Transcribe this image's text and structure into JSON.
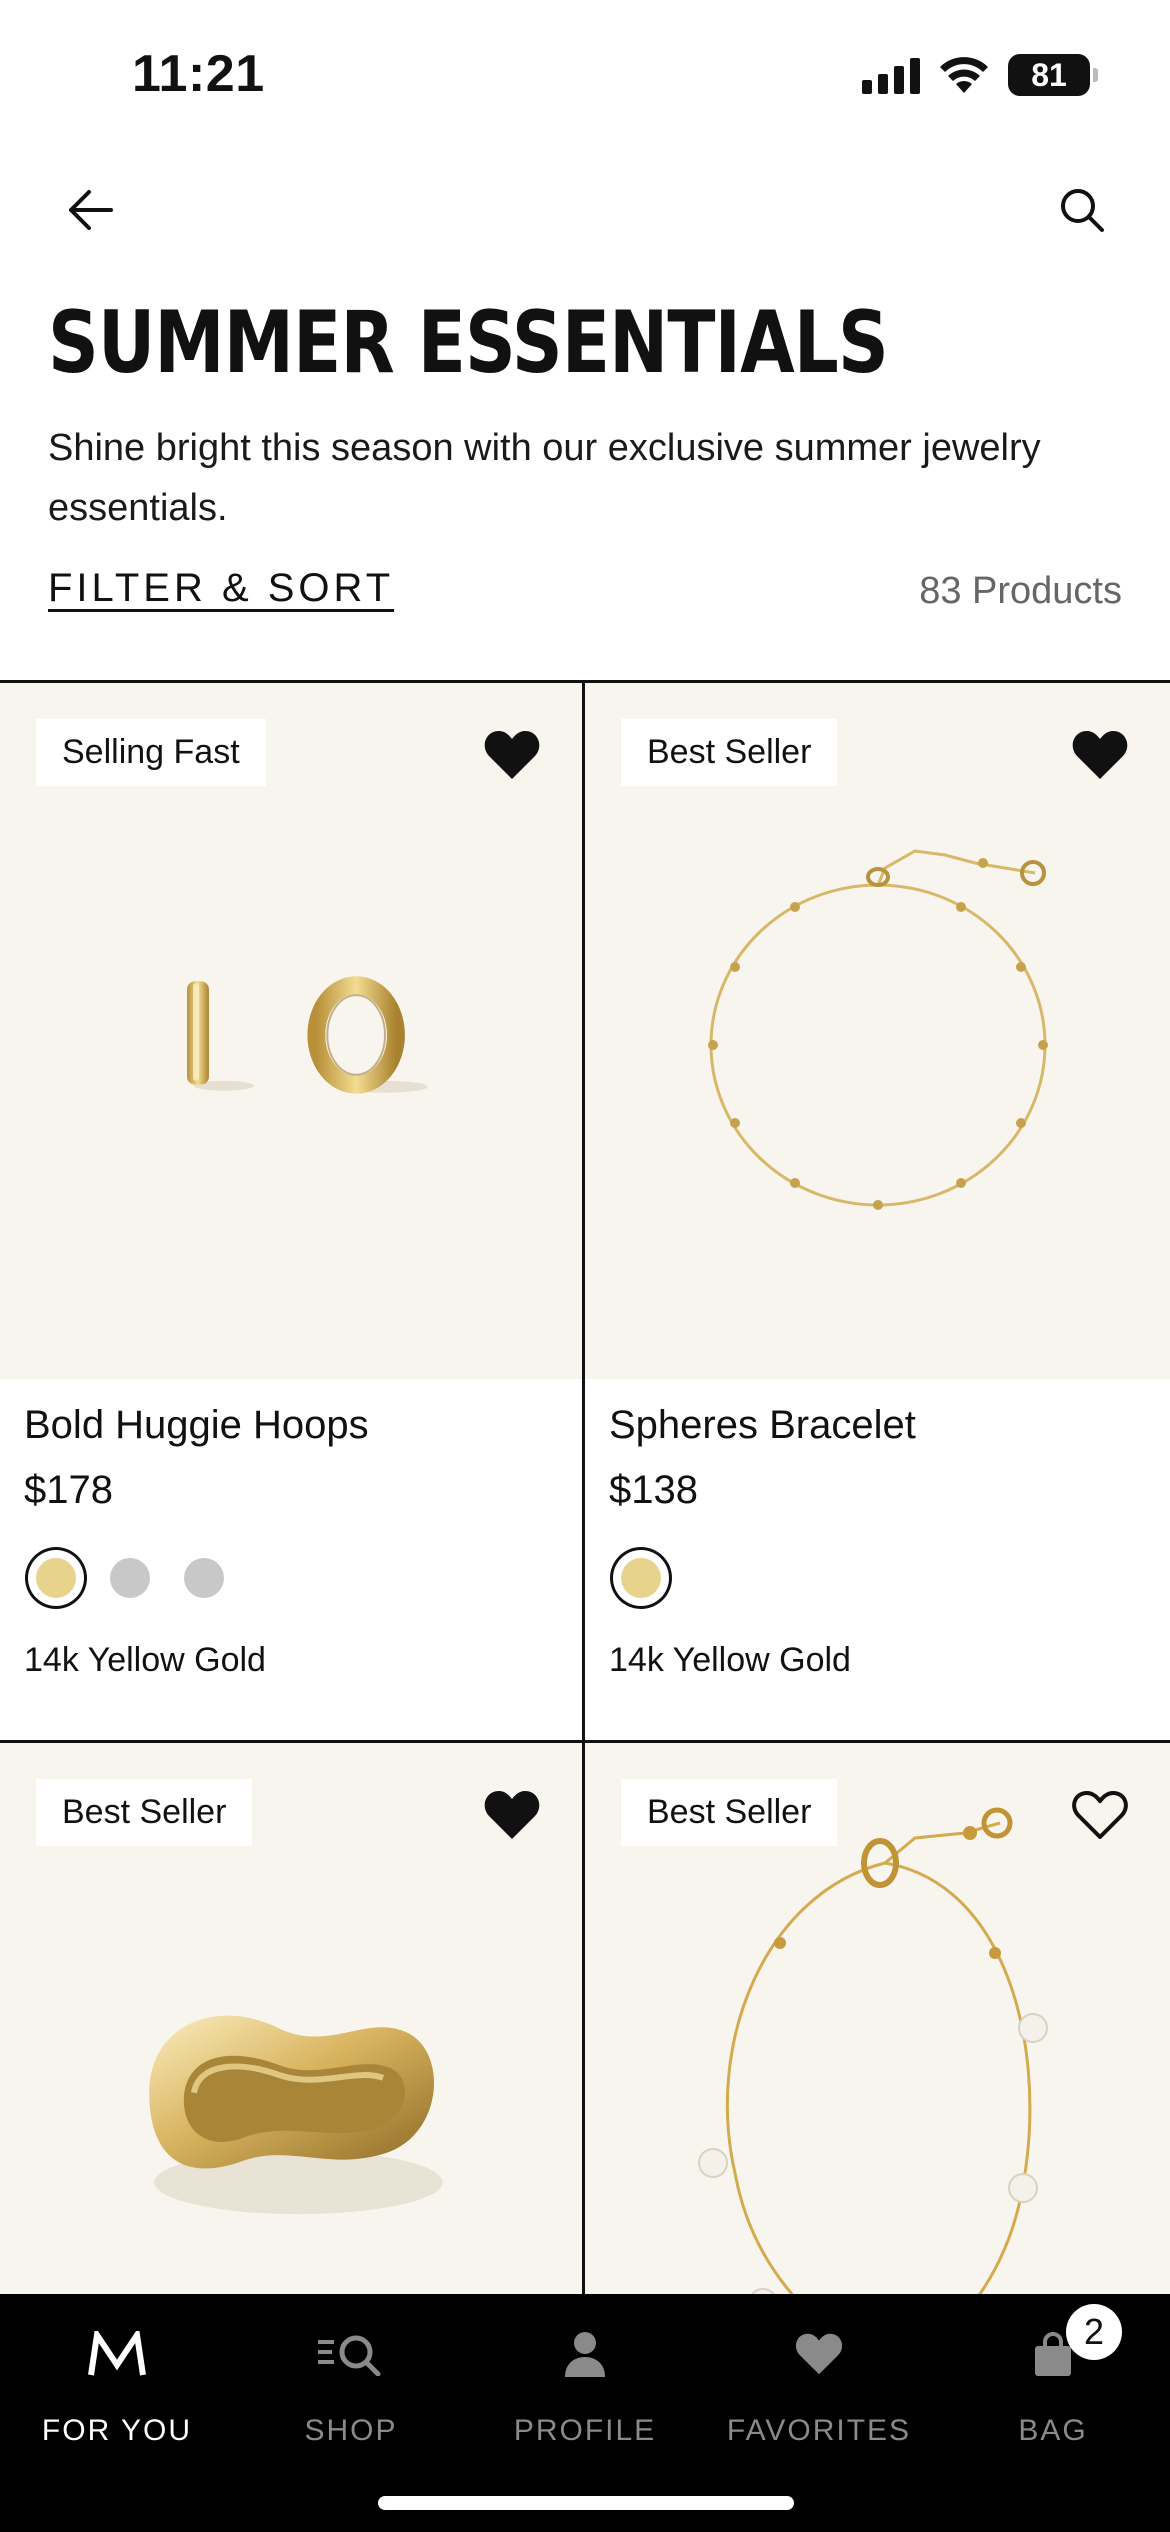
{
  "status_bar": {
    "time": "11:21",
    "battery": "81"
  },
  "header": {
    "title": "SUMMER ESSENTIALS",
    "description": "Shine bright this season with our exclusive summer jewelry essentials.",
    "filter_label": "FILTER & SORT",
    "product_count": "83 Products"
  },
  "products": [
    {
      "badge": "Selling Fast",
      "favorited": true,
      "name": "Bold Huggie Hoops",
      "price": "$178",
      "material": "14k Yellow Gold",
      "swatch_colors": [
        "#e7d38b",
        "#c8c8c8",
        "#c8c8c8"
      ]
    },
    {
      "badge": "Best Seller",
      "favorited": true,
      "name": "Spheres Bracelet",
      "price": "$138",
      "material": "14k Yellow Gold",
      "swatch_colors": [
        "#e7d38b"
      ]
    },
    {
      "badge": "Best Seller",
      "favorited": true
    },
    {
      "badge": "Best Seller",
      "favorited": false
    }
  ],
  "tab_bar": {
    "tabs": [
      {
        "label": "FOR YOU",
        "icon": "brand-m-icon",
        "active": true
      },
      {
        "label": "SHOP",
        "icon": "shop-search-icon",
        "active": false
      },
      {
        "label": "PROFILE",
        "icon": "person-icon",
        "active": false
      },
      {
        "label": "FAVORITES",
        "icon": "heart-icon",
        "active": false
      },
      {
        "label": "BAG",
        "icon": "bag-icon",
        "active": false,
        "badge": "2"
      }
    ]
  },
  "colors": {
    "image_bg": "#f8f5ee",
    "gold": "#e7d38b",
    "text": "#111111",
    "muted": "#666666"
  }
}
